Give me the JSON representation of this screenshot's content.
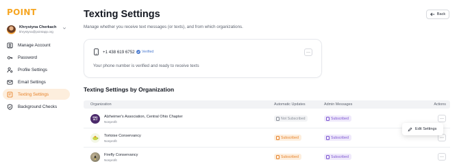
{
  "brand": {
    "logo_text": "POINT",
    "accent": "#f6a623"
  },
  "user": {
    "name": "Khrystyna Cherkach",
    "email": "khrystyna@pointapp.org"
  },
  "sidebar": {
    "items": [
      {
        "label": "Manage Account",
        "icon": "user-square-icon",
        "active": false
      },
      {
        "label": "Password",
        "icon": "key-icon",
        "active": false
      },
      {
        "label": "Profile Settings",
        "icon": "user-settings-icon",
        "active": false
      },
      {
        "label": "Email Settings",
        "icon": "mail-icon",
        "active": false
      },
      {
        "label": "Texting Settings",
        "icon": "message-icon",
        "active": true
      },
      {
        "label": "Background Checks",
        "icon": "shield-check-icon",
        "active": false
      }
    ]
  },
  "header": {
    "title": "Texting Settings",
    "subtitle": "Manage whether you receive text messages (or texts), and from which organizations.",
    "back_label": "Back"
  },
  "phone": {
    "number": "+1 438 619 6752",
    "verified_label": "Verified",
    "menu_label": "···",
    "message": "Your phone number is verified and ready to receive texts"
  },
  "org_section": {
    "title": "Texting Settings by Organization",
    "columns": {
      "organization": "Organization",
      "auto": "Automatic Updates",
      "admin": "Admin Messages",
      "actions": "Actions"
    },
    "rows": [
      {
        "name": "Alzheimer's Association, Central Ohio Chapter",
        "type": "Nonprofit",
        "logo_text": "END ALZ",
        "auto": "Not Subscribed",
        "auto_state": "off",
        "admin": "Subscribed",
        "menu_label": "···"
      },
      {
        "name": "Tortoise Conservancy",
        "type": "Nonprofit",
        "logo_text": "",
        "auto": "Subscribed",
        "auto_state": "orange",
        "admin": "Subscribed",
        "menu_label": "···"
      },
      {
        "name": "Firefly Conservancy",
        "type": "Nonprofit",
        "logo_text": "",
        "auto": "Subscribed",
        "auto_state": "orange",
        "admin": "Subscribed",
        "menu_label": "···"
      }
    ]
  },
  "dropdown": {
    "edit_label": "Edit Settings"
  }
}
